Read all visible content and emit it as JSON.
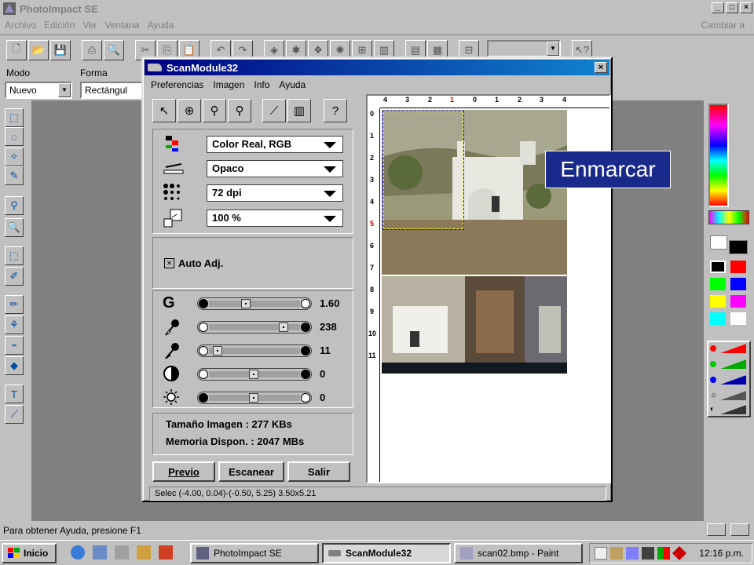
{
  "app": {
    "title": "PhotoImpact SE",
    "menu": [
      "Archivo",
      "Edición",
      "Ver",
      "Ventana",
      "Ayuda"
    ],
    "menu_right": "Cambiar a",
    "mode_label": "Modo",
    "mode_value": "Nuevo",
    "shape_label": "Forma",
    "shape_value": "Rectángul",
    "status": "Para obtener Ayuda, presione F1"
  },
  "scan": {
    "title": "ScanModule32",
    "menu": [
      "Preferencias",
      "Imagen",
      "Info",
      "Ayuda"
    ],
    "color_mode": "Color Real, RGB",
    "scan_type": "Opaco",
    "resolution": "72 dpi",
    "scale": "100 %",
    "auto_adj": "Auto Adj.",
    "sliders": [
      {
        "icon": "G",
        "value": "1.60",
        "pos": 0.4
      },
      {
        "icon": "eyedropper-black",
        "value": "238",
        "pos": 0.87
      },
      {
        "icon": "eyedropper-gray",
        "value": "11",
        "pos": 0.05
      },
      {
        "icon": "contrast",
        "value": "0",
        "pos": 0.5
      },
      {
        "icon": "brightness",
        "value": "0",
        "pos": 0.5
      }
    ],
    "image_size": "Tamaño Imagen : 277 KBs",
    "memory": "Memoria Dispon. : 2047 MBs",
    "buttons": {
      "preview": "Previo",
      "scan": "Escanear",
      "exit": "Salir"
    },
    "status": "Selec (-4.00, 0.04)-(-0.50, 5.25) 3.50x5.21",
    "ruler_top": [
      "4",
      "3",
      "2",
      "1",
      "0",
      "1",
      "2",
      "3",
      "4"
    ],
    "ruler_left": [
      "0",
      "1",
      "2",
      "3",
      "4",
      "5",
      "6",
      "7",
      "8",
      "9",
      "10",
      "11"
    ]
  },
  "overlay": {
    "label": "Enmarcar"
  },
  "taskbar": {
    "start": "Inicio",
    "tasks": [
      "PhotoImpact SE",
      "ScanModule32",
      "scan02.bmp - Paint"
    ],
    "clock": "12:16 p.m."
  },
  "colors": {
    "title_active": "#000080",
    "overlay_bg": "#1a2a8a"
  }
}
